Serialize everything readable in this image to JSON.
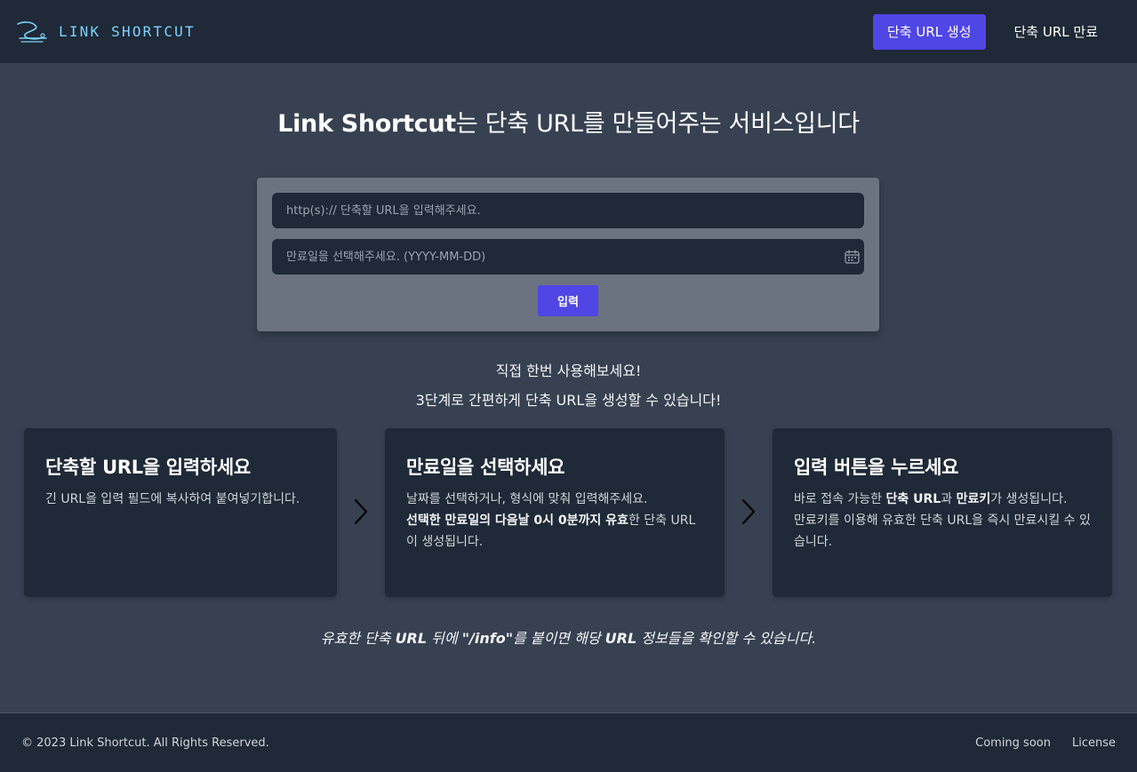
{
  "header": {
    "brand_name": "LINK SHORTCUT",
    "logo_icon": "link-logo-icon",
    "nav": {
      "create_label": "단축 URL 생성",
      "expire_label": "단축 URL 만료"
    }
  },
  "hero": {
    "title_bold": "Link Shortcut",
    "title_rest": "는 단축 URL를 만들어주는 서비스입니다"
  },
  "form": {
    "url_placeholder": "http(s):// 단축할 URL을 입력해주세요.",
    "url_value": "",
    "date_placeholder": "만료일을 선택해주세요. (YYYY-MM-DD)",
    "date_value": "",
    "date_icon": "calendar-icon",
    "submit_label": "입력"
  },
  "tagline": {
    "line1": "직접 한번 사용해보세요!",
    "line2": "3단계로 간편하게 단축 URL을 생성할 수 있습니다!"
  },
  "steps": [
    {
      "title": "단축할 URL을 입력하세요",
      "desc": "긴 URL을 입력 필드에 복사하여 붙여넣기합니다."
    },
    {
      "title": "만료일을 선택하세요",
      "desc_line1": "날짜를 선택하거나, 형식에 맞춰 입력해주세요.",
      "desc_bold": "선택한 만료일의 다음날 0시 0분까지 유효",
      "desc_rest": "한 단축 URL이 생성됩니다."
    },
    {
      "title": "입력 버튼을 누르세요",
      "desc_pre": "바로 접속 가능한 ",
      "desc_bold1": "단축 URL",
      "desc_mid": "과 ",
      "desc_bold2": "만료키",
      "desc_post": "가 생성됩니다.",
      "desc_line2": "만료키를 이용해 유효한 단축 URL을 즉시 만료시킬 수 있습니다."
    }
  ],
  "arrow_icon": "chevron-right-icon",
  "info_note": {
    "pre": "유효한 단축 ",
    "bold1": "URL",
    "mid1": " 뒤에 ",
    "bold2": "\"/info\"",
    "mid2": "를 붙이면 해당 ",
    "bold3": "URL",
    "post": " 정보들을 확인할 수 있습니다."
  },
  "footer": {
    "copyright": "© 2023 Link Shortcut. All Rights Reserved.",
    "links": [
      "Coming soon",
      "License"
    ]
  },
  "colors": {
    "accent": "#4f46e5",
    "header_bg": "#1f2937",
    "page_bg": "#374151",
    "card_bg": "#6b7280",
    "brand": "#7dd3fc"
  }
}
